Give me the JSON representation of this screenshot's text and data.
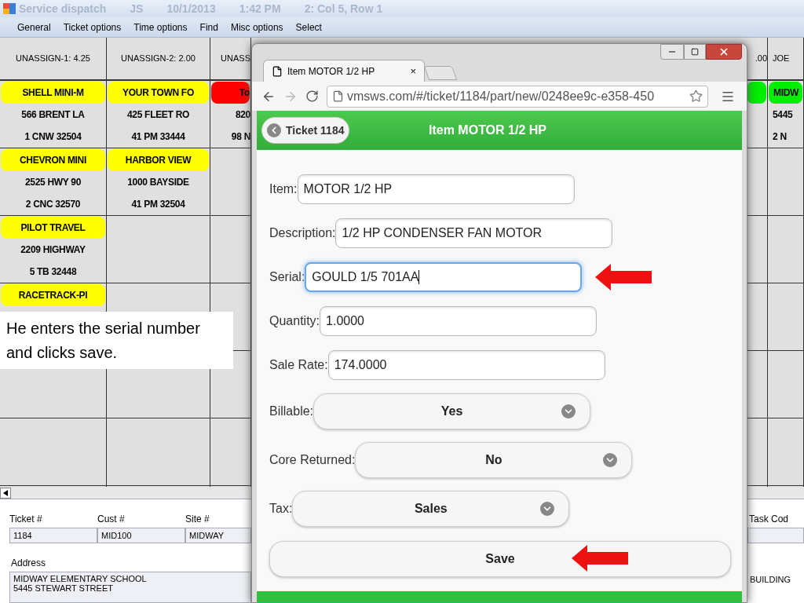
{
  "app": {
    "title": "Service dispatch",
    "user": "JS",
    "date": "10/1/2013",
    "time": "1:42 PM",
    "position": "2: Col 5, Row 1"
  },
  "menu": [
    "General",
    "Ticket options",
    "Time options",
    "Find",
    "Misc options",
    "Select"
  ],
  "board": {
    "columns": [
      {
        "header": "UNASSIGN-1: 4.25",
        "tickets": [
          {
            "name": "SHELL MINI-M",
            "address": "566 BRENT LA",
            "line3": "1 CNW 32504",
            "color": "#ffff00"
          },
          {
            "name": "CHEVRON MINI",
            "address": "2525 HWY 90",
            "line3": "2 CNC 32570",
            "color": "#ffff00"
          },
          {
            "name": "PILOT TRAVEL",
            "address": "2209 HIGHWAY",
            "line3": "5 TB 32448",
            "color": "#ffff00"
          },
          {
            "name": "RACETRACK-PI",
            "color": "#ffff00"
          }
        ]
      },
      {
        "header": "UNASSIGN-2: 2.00",
        "tickets": [
          {
            "name": "YOUR TOWN FO",
            "address": "425 FLEET RO",
            "line3": "41 PM 33444",
            "color": "#ffff00"
          },
          {
            "name": "HARBOR VIEW",
            "address": "1000 BAYSIDE",
            "line3": "41 PM 32504",
            "color": "#ffff00"
          }
        ]
      },
      {
        "header": "UNASS",
        "tickets": [
          {
            "name": "To",
            "address": "820",
            "line3": "98 N",
            "color": "#ff0000"
          }
        ]
      },
      {
        "header": ".00",
        "tickets": [
          {
            "color": "#00ee00"
          }
        ]
      },
      {
        "header": "JOE",
        "tickets": [
          {
            "name": "MIDW",
            "address": "5445",
            "line3": "2 N",
            "color": "#00ee00"
          }
        ]
      }
    ]
  },
  "browser": {
    "tab_title": "Item MOTOR 1/2 HP",
    "tab_close": "×",
    "url": "vmsws.com/#/ticket/1184/part/new/0248ee9c-e358-450",
    "back_button": "Ticket 1184",
    "page_title": "Item MOTOR 1/2 HP",
    "fields": [
      {
        "kind": "text",
        "label": "Item:",
        "value": "MOTOR 1/2 HP",
        "focused": false
      },
      {
        "kind": "text",
        "label": "Description:",
        "value": "1/2 HP CONDENSER FAN MOTOR",
        "focused": false
      },
      {
        "kind": "text",
        "label": "Serial:",
        "value": "GOULD 1/5 701AA",
        "focused": true
      },
      {
        "kind": "text",
        "label": "Quantity:",
        "value": "1.0000",
        "focused": false
      },
      {
        "kind": "text",
        "label": "Sale Rate:",
        "value": "174.0000",
        "focused": false
      },
      {
        "kind": "select",
        "label": "Billable:",
        "value": "Yes"
      },
      {
        "kind": "select",
        "label": "Core Returned:",
        "value": "No"
      },
      {
        "kind": "select",
        "label": "Tax:",
        "value": "Sales"
      }
    ],
    "save_button": "Save"
  },
  "caption": "He enters the serial number and clicks save.",
  "details": {
    "fields": [
      {
        "label": "Ticket #",
        "value": "1184"
      },
      {
        "label": "Cust #",
        "value": "MID100"
      },
      {
        "label": "Site #",
        "value": "MIDWAY"
      }
    ],
    "address_label": "Address",
    "address_lines": [
      "MIDWAY ELEMENTARY SCHOOL",
      "5445 STEWART STREET"
    ],
    "right_label": "Task Cod",
    "right_value": "BUILDING"
  }
}
